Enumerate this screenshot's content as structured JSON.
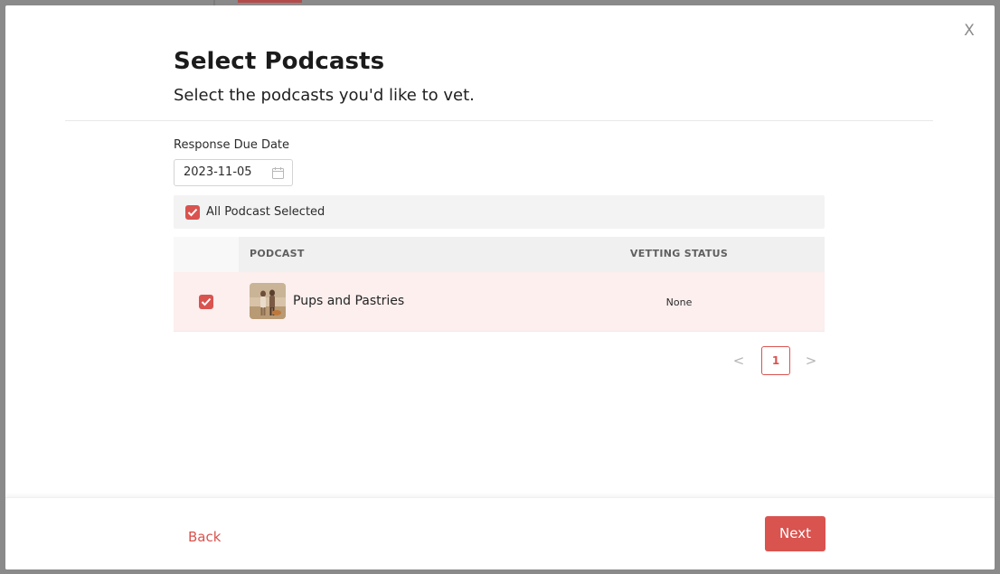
{
  "modal": {
    "title": "Select Podcasts",
    "subtitle": "Select the podcasts you'd like to vet.",
    "close_label": "X"
  },
  "due_date": {
    "label": "Response Due Date",
    "value": "2023-11-05"
  },
  "select_all": {
    "label": "All Podcast Selected",
    "checked": true
  },
  "table": {
    "columns": [
      "PODCAST",
      "VETTING STATUS"
    ],
    "rows": [
      {
        "selected": true,
        "podcast": "Pups and Pastries",
        "vetting_status": "None"
      }
    ]
  },
  "pagination": {
    "prev_symbol": "<",
    "current_page": "1",
    "next_symbol": ">"
  },
  "footer": {
    "back_label": "Back",
    "next_label": "Next"
  },
  "colors": {
    "accent": "#d9534f",
    "row_selected_bg": "#fcefee",
    "overlay": "#8a8a8a"
  }
}
